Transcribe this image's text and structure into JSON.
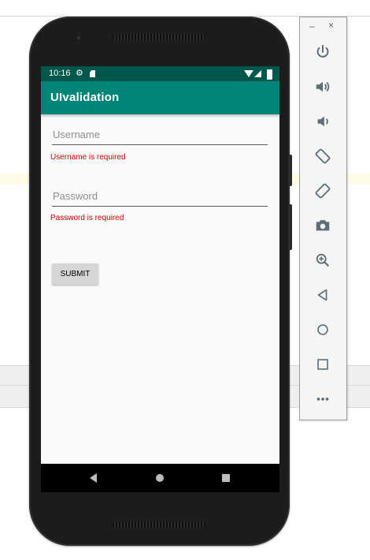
{
  "status_bar": {
    "time": "10:16"
  },
  "app_bar": {
    "title": "UIvalidation"
  },
  "form": {
    "username": {
      "placeholder": "Username",
      "value": "",
      "error": "Username is required"
    },
    "password": {
      "placeholder": "Password",
      "value": "",
      "error": "Password is required"
    },
    "submit_label": "SUBMIT"
  },
  "emulator_toolbar": {
    "minimize": "–",
    "close": "×",
    "buttons": [
      "power-icon",
      "volume-up-icon",
      "volume-down-icon",
      "rotate-left-icon",
      "rotate-right-icon",
      "camera-icon",
      "zoom-icon",
      "back-icon",
      "home-icon",
      "overview-icon",
      "more-icon"
    ]
  },
  "colors": {
    "app_bar": "#008577",
    "status_bar": "#00574b",
    "error": "#d50000",
    "toolbar_icon": "#5f6f7a"
  }
}
